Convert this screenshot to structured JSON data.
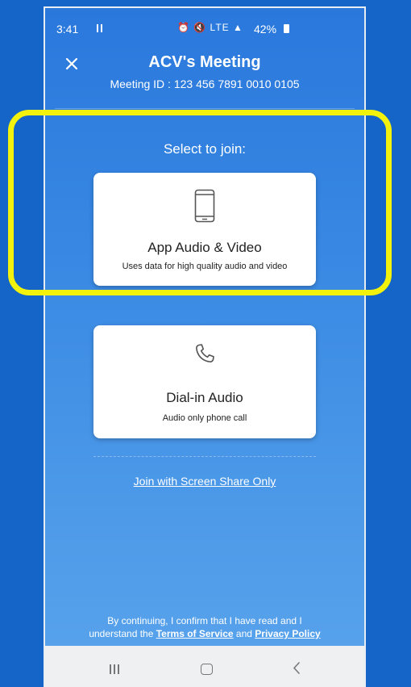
{
  "status_bar": {
    "time": "3:41",
    "icons": "⏰ 🔇 LTE ▲",
    "battery": "42%"
  },
  "header": {
    "title": "ACV's Meeting",
    "meeting_id": "Meeting ID : 123 456 7891 0010 0105"
  },
  "join": {
    "prompt": "Select to join:",
    "options": [
      {
        "title": "App Audio & Video",
        "subtitle": "Uses data for high quality audio and video",
        "icon": "smartphone-icon"
      },
      {
        "title": "Dial-in Audio",
        "subtitle": "Audio only phone call",
        "icon": "phone-icon"
      }
    ],
    "screen_share_link": "Join with Screen Share Only"
  },
  "footer": {
    "line1": "By continuing, I confirm that I have read and I",
    "line2_prefix": "understand the",
    "terms_link": "Terms of Service",
    "and": "and",
    "privacy_link": "Privacy Policy"
  },
  "colors": {
    "background": "#1565c8",
    "highlight": "#f2f20c",
    "screen_gradient_top": "#2a78dc"
  }
}
